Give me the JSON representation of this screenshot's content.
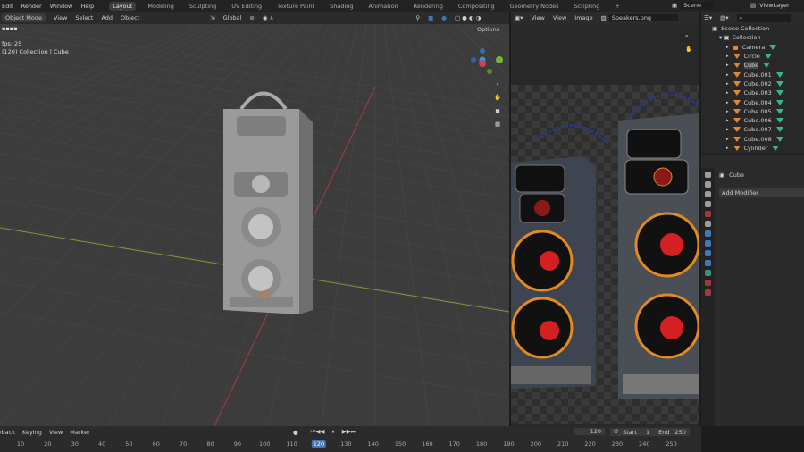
{
  "menu": [
    "Edit",
    "Render",
    "Window",
    "Help"
  ],
  "workspaces": [
    "Layout",
    "Modeling",
    "Sculpting",
    "UV Editing",
    "Texture Paint",
    "Shading",
    "Animation",
    "Rendering",
    "Compositing",
    "Geometry Nodes",
    "Scripting",
    "+"
  ],
  "scene": {
    "name": "Scene",
    "view_layer": "ViewLayer"
  },
  "viewport": {
    "mode": "Object Mode",
    "menus": [
      "View",
      "Select",
      "Add",
      "Object"
    ],
    "orientation": "Global",
    "options": "Options",
    "fps": "fps: 25",
    "info": "(120) Collection | Cube"
  },
  "image_editor": {
    "menus": [
      "View",
      "View",
      "Image"
    ],
    "image": "Speakers.png"
  },
  "outliner": {
    "scene_collection": "Scene Collection",
    "collection": "Collection",
    "items": [
      "Camera",
      "Circle",
      "Cube",
      "Cube.001",
      "Cube.002",
      "Cube.003",
      "Cube.004",
      "Cube.005",
      "Cube.006",
      "Cube.007",
      "Cube.008",
      "Cylinder"
    ]
  },
  "properties": {
    "object": "Cube",
    "add_modifier": "Add Modifier"
  },
  "timeline": {
    "menus": [
      "Playback",
      "Keying",
      "View",
      "Marker"
    ],
    "current_frame": "120",
    "start_label": "Start",
    "start": "1",
    "end_label": "End",
    "end": "250",
    "ticks": [
      "10",
      "20",
      "30",
      "40",
      "50",
      "60",
      "70",
      "80",
      "90",
      "100",
      "110",
      "120",
      "130",
      "140",
      "150",
      "160",
      "170",
      "180",
      "190",
      "200",
      "210",
      "220",
      "230",
      "240",
      "250"
    ]
  },
  "colors": {
    "accent": "#4772b3",
    "object": "#e0883a",
    "modifier": "#3cb48a"
  }
}
